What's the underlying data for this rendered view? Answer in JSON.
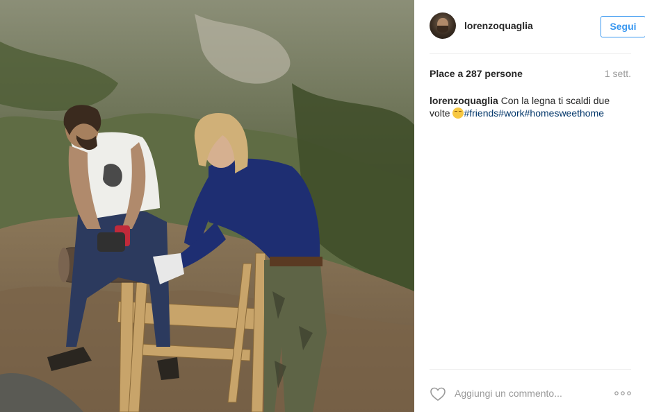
{
  "post": {
    "image_description_icon": "photo",
    "user": {
      "username": "lorenzoquaglia"
    },
    "follow_label": "Segui",
    "likes_text": "Place a 287 persone",
    "time_ago": "1 sett.",
    "caption": {
      "username": "lorenzoquaglia",
      "text": "Con la legna ti scaldi due volte",
      "emoji": "smiling-face-emoji",
      "hashtags": [
        "#friends",
        "#work",
        "#homesweethome"
      ]
    },
    "comment": {
      "placeholder": "Aggiungi un commento..."
    },
    "icons": {
      "like": "heart-icon",
      "more": "more-options-icon"
    },
    "colors": {
      "accent": "#3897f0",
      "hashtag": "#003569",
      "muted": "#999999",
      "text": "#262626"
    }
  }
}
